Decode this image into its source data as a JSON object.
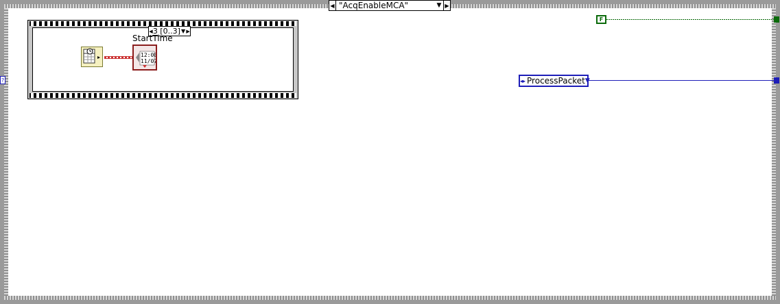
{
  "case_structure": {
    "selector_label": "\"AcqEnableMCA\"",
    "prev_icon": "left-triangle-icon",
    "next_icon": "right-triangle-icon",
    "dropdown_icon": "down-triangle-icon"
  },
  "sequence": {
    "selector_label": "3 [0..3]",
    "indicator_label": "StartTime",
    "timestamp_text_top": "12:00",
    "timestamp_text_bottom": "11/07"
  },
  "constants": {
    "boolean_label": "F",
    "enum_label": "ProcessPacket",
    "left_tunnel_label": "?"
  },
  "colors": {
    "boolean_wire": "#0a6a0a",
    "enum_wire": "#1d1db8",
    "timestamp_wire": "#cc3333",
    "frame_gray": "#9a9a9a"
  }
}
